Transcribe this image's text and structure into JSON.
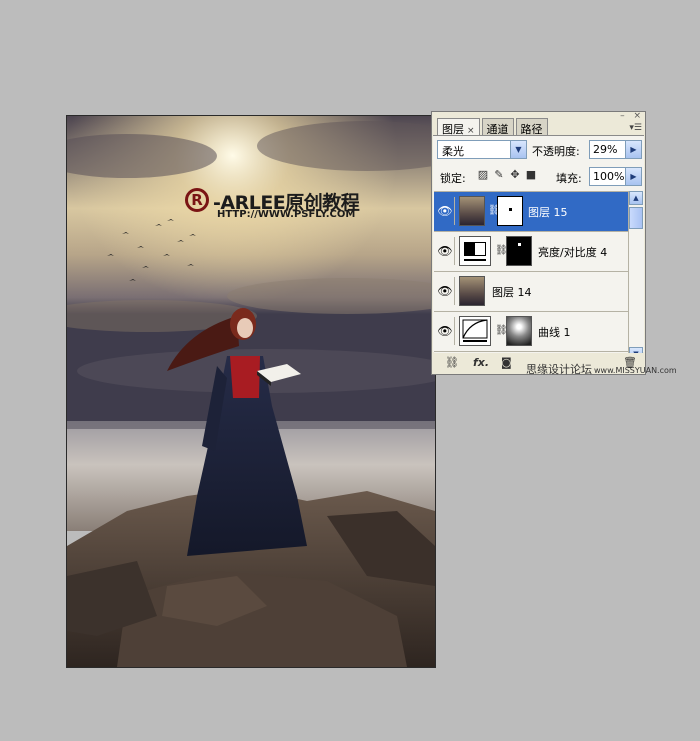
{
  "watermark": {
    "logo": "R",
    "title": "-ARLEE原创教程",
    "url": "HTTP://WWW.PSFLY.COM"
  },
  "panel": {
    "tabs": [
      {
        "label": "图层",
        "active": true,
        "close": "×"
      },
      {
        "label": "通道",
        "active": false
      },
      {
        "label": "路径",
        "active": false
      }
    ],
    "window_buttons": {
      "minimize": "–",
      "close": "×"
    },
    "menu_icon": "▾☰",
    "blend_mode": "柔光",
    "opacity_label": "不透明度:",
    "opacity_value": "29%",
    "lock_label": "锁定:",
    "fill_label": "填充:",
    "fill_value": "100%",
    "layers": [
      {
        "name": "图层 15",
        "selected": true,
        "has_mask": true,
        "thumb": "photo"
      },
      {
        "name": "亮度/对比度 4",
        "selected": false,
        "has_mask": true,
        "thumb": "brightness-contrast"
      },
      {
        "name": "图层 14",
        "selected": false,
        "has_mask": false,
        "thumb": "photo"
      },
      {
        "name": "曲线 1",
        "selected": false,
        "has_mask": true,
        "thumb": "curves"
      }
    ],
    "toolbar_icons": [
      "link-icon",
      "fx-icon",
      "mask-icon",
      "trash-icon"
    ],
    "fx_label": "fx."
  },
  "forum_watermark": {
    "text": "思缘设计论坛",
    "url": "www.MISSYUAN.com"
  },
  "colors": {
    "selected_row": "#316ac5",
    "panel_bg": "#ece9d8",
    "workspace": "#bcbcbc",
    "logo": "#7a1414"
  }
}
